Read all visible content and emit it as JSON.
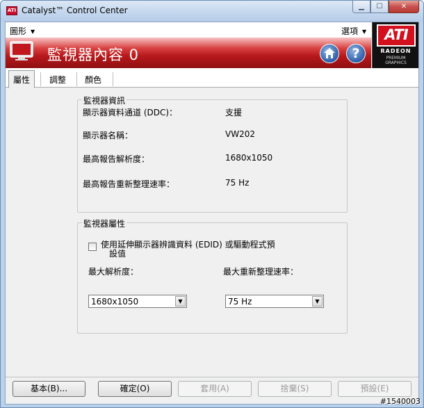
{
  "window": {
    "title": "Catalyst™ Control Center"
  },
  "menu": {
    "graphics_label": "圖形",
    "options_label": "選項"
  },
  "banner": {
    "title": "監視器內容 0",
    "help_glyph": "?"
  },
  "logo": {
    "brand": "ATI",
    "line1": "RADEON",
    "line2": "PREMIUM",
    "line3": "GRAPHICS"
  },
  "tabs": [
    {
      "label": "屬性",
      "active": true
    },
    {
      "label": "調整",
      "active": false
    },
    {
      "label": "顏色",
      "active": false
    }
  ],
  "monitor_info": {
    "legend": "監視器資訊",
    "rows": [
      {
        "label": "顯示器資料通道 (DDC)：",
        "value": "支援"
      },
      {
        "label": "顯示器名稱：",
        "value": "VW202"
      },
      {
        "label": "最高報告解析度：",
        "value": "1680x1050"
      },
      {
        "label": "最高報告重新整理速率：",
        "value": "75 Hz"
      }
    ]
  },
  "monitor_props": {
    "legend": "監視器屬性",
    "edid_line1": "使用延伸顯示器辨識資料 (EDID) 或驅動程式預",
    "edid_line2": "設值",
    "edid_checked": false,
    "max_res_label": "最大解析度：",
    "max_res_value": "1680x1050",
    "max_refresh_label": "最大重新整理速率：",
    "max_refresh_value": "75 Hz"
  },
  "buttons": {
    "basic": "基本(B)...",
    "ok": "確定(O)",
    "apply": "套用(A)",
    "discard": "捨棄(S)",
    "defaults": "預設(E)"
  },
  "watermark": "#1540003",
  "colors": {
    "banner_red": "#b7191c",
    "ati_red": "#d2101e",
    "titlebar": "#c3d6ee"
  }
}
